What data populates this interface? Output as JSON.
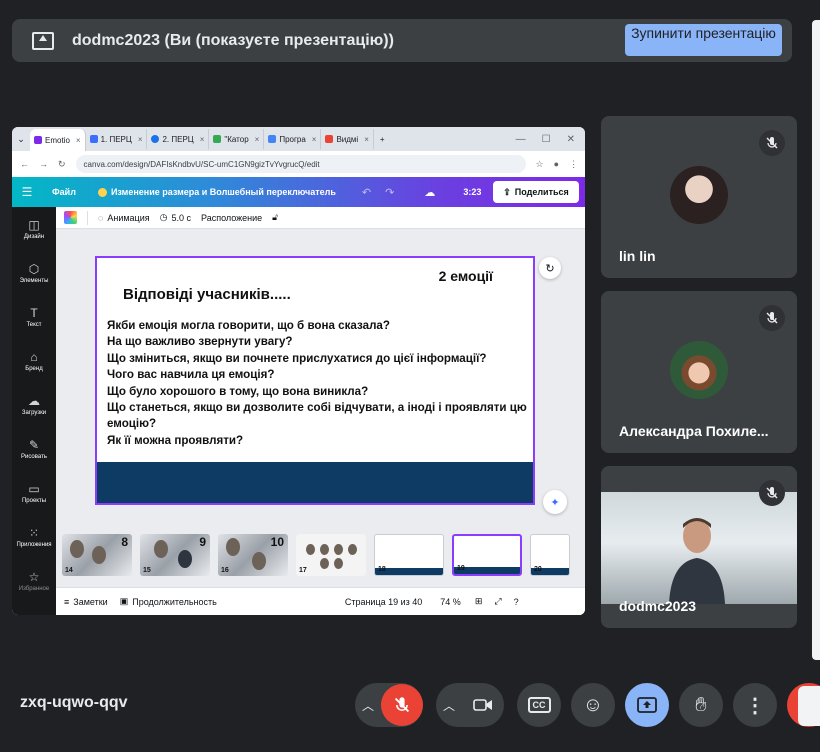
{
  "banner": {
    "title": "dodmc2023 (Ви (показуєте презентацію))",
    "stop_label": "Зупинити презентацію"
  },
  "browser": {
    "tabs": [
      {
        "label": "Emotio",
        "color": "#7d2ae8"
      },
      {
        "label": "1. ПЕРЦ",
        "color": "#3b6dff"
      },
      {
        "label": "2. ПЕРЦ",
        "color": "#1a73e8"
      },
      {
        "label": "\"Катор",
        "color": "#34a853"
      },
      {
        "label": "Програ",
        "color": "#4285f4"
      },
      {
        "label": "Видмі",
        "color": "#ea4335"
      }
    ],
    "new_tab": "+",
    "url": "canva.com/design/DAFIsKndbvU/SC-umC1GN9gizTvYvgrucQ/edit"
  },
  "canva": {
    "menu_file": "Файл",
    "resize_label": "Изменение размера и Волшебный переключатель",
    "timer": "3:23",
    "share_label": "Поделиться",
    "sidebar": [
      {
        "label": "Дизайн",
        "icon": "layout-icon"
      },
      {
        "label": "Элементы",
        "icon": "shapes-icon"
      },
      {
        "label": "Текст",
        "icon": "text-icon"
      },
      {
        "label": "Бренд",
        "icon": "brand-icon"
      },
      {
        "label": "Загрузки",
        "icon": "upload-icon"
      },
      {
        "label": "Рисовать",
        "icon": "draw-icon"
      },
      {
        "label": "Проекты",
        "icon": "folder-icon"
      },
      {
        "label": "Приложения",
        "icon": "apps-icon"
      },
      {
        "label": "Избранное",
        "icon": "star-icon"
      }
    ],
    "toolbar": {
      "animation": "Анимация",
      "duration": "5.0 с",
      "position": "Расположение"
    },
    "slide": {
      "emotions": "2 емоції",
      "heading": "Відповіді учасників.....",
      "questions": [
        "Якби емоція могла говорити, що б вона сказала?",
        "На що важливо звернути увагу?",
        "Що зміниться, якщо ви почнете прислухатися до цієї інформації?",
        "Чого вас навчила ця емоція?",
        "Що було хорошого в тому, що вона виникла?",
        "Що станеться, якщо ви дозволите собі відчувати, а іноді і проявляти цю емоцію?",
        "Як її можна проявляти?"
      ]
    },
    "thumbnails": [
      {
        "num": "14",
        "big": "8"
      },
      {
        "num": "15",
        "big": "9"
      },
      {
        "num": "16",
        "big": "10"
      },
      {
        "num": "17",
        "big": ""
      },
      {
        "num": "18",
        "big": ""
      },
      {
        "num": "19",
        "big": ""
      },
      {
        "num": "20",
        "big": ""
      }
    ],
    "status": {
      "notes": "Заметки",
      "duration": "Продолжительность",
      "page": "Страница 19 из 40",
      "zoom": "74 %"
    }
  },
  "participants": [
    {
      "name": "lin lin"
    },
    {
      "name": "Александра Похиле..."
    },
    {
      "name": "dodmc2023"
    }
  ],
  "meeting": {
    "code": "zxq-uqwo-qqv"
  },
  "colors": {
    "background": "#202124",
    "tile": "#3c4043",
    "accent": "#8ab4f8",
    "mic_off": "#ea4335"
  }
}
